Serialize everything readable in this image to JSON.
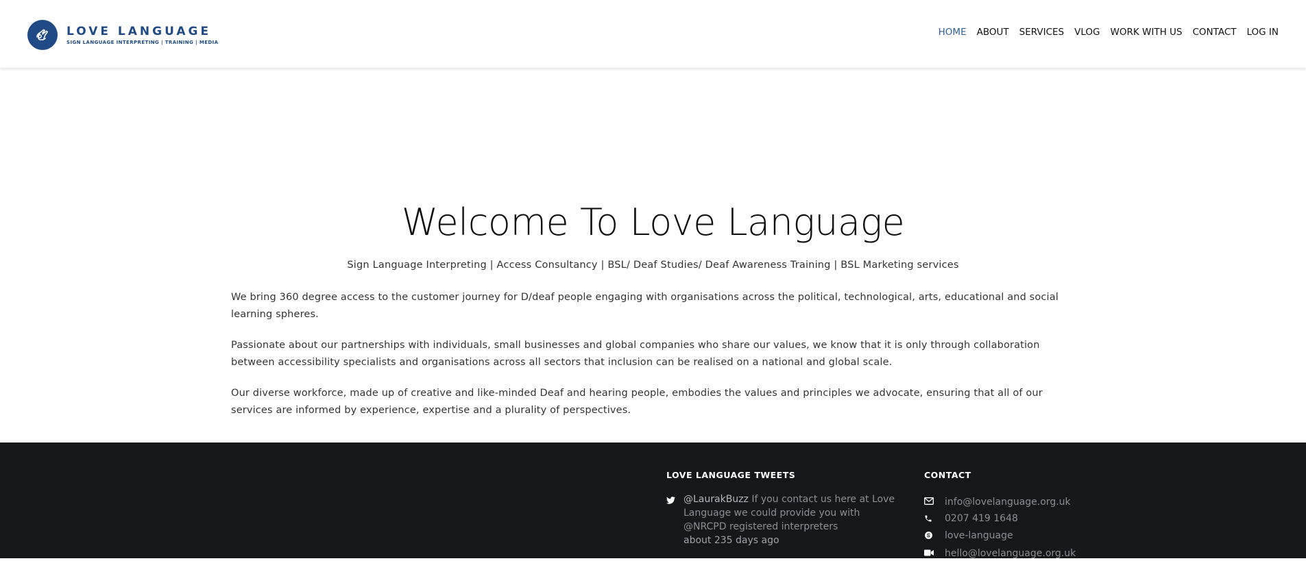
{
  "brand": {
    "name": "LOVE LANGUAGE",
    "tagline": "SIGN LANGUAGE INTERPRETING | TRAINING | MEDIA",
    "color": "#1f4a86"
  },
  "nav": {
    "items": [
      {
        "label": "HOME",
        "active": true
      },
      {
        "label": "ABOUT"
      },
      {
        "label": "SERVICES"
      },
      {
        "label": "VLOG"
      },
      {
        "label": "WORK WITH US"
      },
      {
        "label": "CONTACT"
      },
      {
        "label": "LOG IN"
      }
    ],
    "active_color": "#2f5e9c"
  },
  "hero": {
    "title": "Welcome To Love Language",
    "subtitle": "Sign Language Interpreting | Access Consultancy | BSL/ Deaf Studies/ Deaf Awareness Training | BSL Marketing services",
    "paragraphs": [
      "We bring 360 degree access to the customer journey for D/deaf people engaging with organisations across the political, technological, arts, educational and social learning spheres.",
      "Passionate about our partnerships with individuals, small businesses and global companies who share our values, we know that it is only through collaboration between accessibility specialists and organisations across all sectors that inclusion can be realised on a national and global scale.",
      "Our diverse workforce, made up of creative and like-minded Deaf and hearing people, embodies the values and principles we advocate, ensuring that all of our services are informed by experience, expertise and a plurality of perspectives."
    ]
  },
  "footer": {
    "background": "#16171a",
    "tweets": {
      "heading": "LOVE LANGUAGE TWEETS",
      "items": [
        {
          "icon": "twitter-icon",
          "handle": "@LaurakBuzz",
          "text": " If you contact us here at Love Language we could provide you with @NRCPD registered interpreters",
          "time": "about 235 days ago"
        }
      ]
    },
    "contact": {
      "heading": "CONTACT",
      "items": [
        {
          "icon": "envelope-icon",
          "value": "info@lovelanguage.org.uk"
        },
        {
          "icon": "phone-icon",
          "value": "0207 419 1648"
        },
        {
          "icon": "skype-icon",
          "value": "love-language"
        },
        {
          "icon": "video-icon",
          "value": "hello@lovelanguage.org.uk"
        }
      ]
    }
  }
}
